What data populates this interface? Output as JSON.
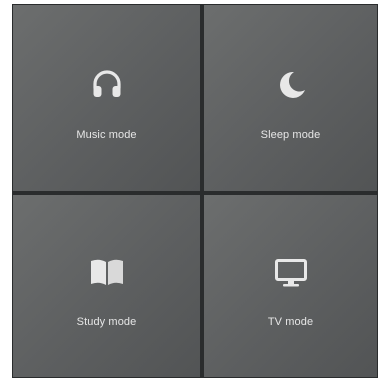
{
  "panel": {
    "tiles": [
      {
        "label": "Music mode",
        "icon": "headphones-icon"
      },
      {
        "label": "Sleep mode",
        "icon": "moon-icon"
      },
      {
        "label": "Study mode",
        "icon": "book-icon"
      },
      {
        "label": "TV mode",
        "icon": "tv-icon"
      }
    ]
  },
  "colors": {
    "tile": "#5d5f60",
    "divider": "#2a2c2d",
    "icon": "#e8e8e8",
    "text": "#e6e6e6"
  }
}
